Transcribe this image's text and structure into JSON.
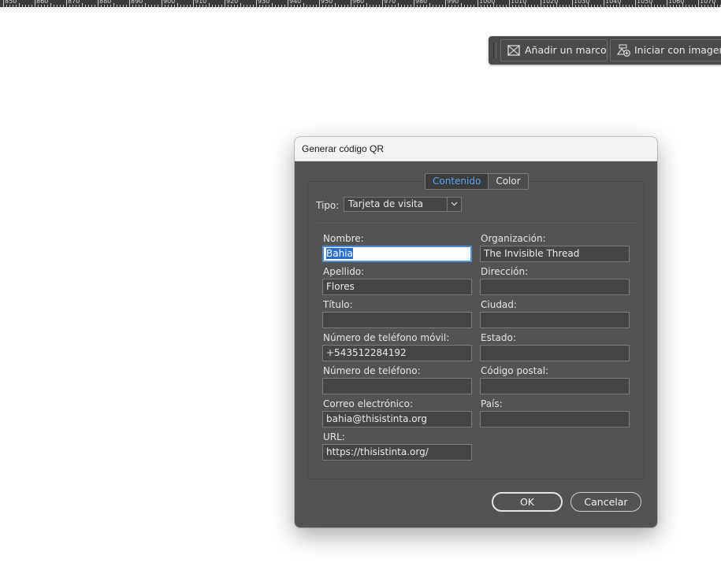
{
  "ruler": {
    "labels": [
      "850",
      "860",
      "870",
      "880",
      "890",
      "900",
      "910",
      "920",
      "930",
      "940",
      "950",
      "960",
      "970",
      "980",
      "990",
      "1000",
      "1010",
      "1020",
      "1030",
      "1040",
      "1050",
      "1060",
      "1070"
    ]
  },
  "context_bar": {
    "add_frame_label": "Añadir un marco",
    "start_with_image_label": "Iniciar con imagen"
  },
  "dialog": {
    "title": "Generar código QR",
    "tabs": [
      {
        "label": "Contenido",
        "active": true
      },
      {
        "label": "Color",
        "active": false
      }
    ],
    "type_label": "Tipo:",
    "type_value": "Tarjeta de visita",
    "fields": {
      "nombre": {
        "label": "Nombre:",
        "value": "Bahia"
      },
      "apellido": {
        "label": "Apellido:",
        "value": "Flores"
      },
      "titulo": {
        "label": "Título:",
        "value": ""
      },
      "movil": {
        "label": "Número de teléfono móvil:",
        "value": "+543512284192"
      },
      "telefono": {
        "label": "Número de teléfono:",
        "value": ""
      },
      "correo": {
        "label": "Correo electrónico:",
        "value": "bahia@thisistinta.org"
      },
      "url": {
        "label": "URL:",
        "value": "https://thisistinta.org/"
      },
      "organizacion": {
        "label": "Organización:",
        "value": "The Invisible Thread"
      },
      "direccion": {
        "label": "Dirección:",
        "value": ""
      },
      "ciudad": {
        "label": "Ciudad:",
        "value": ""
      },
      "estado": {
        "label": "Estado:",
        "value": ""
      },
      "codigo_postal": {
        "label": "Código postal:",
        "value": ""
      },
      "pais": {
        "label": "País:",
        "value": ""
      }
    },
    "ok_label": "OK",
    "cancel_label": "Cancelar"
  },
  "colors": {
    "dialog_bg": "#535353",
    "tab_active_text": "#58a6f2",
    "selection": "#2a6ed1"
  }
}
